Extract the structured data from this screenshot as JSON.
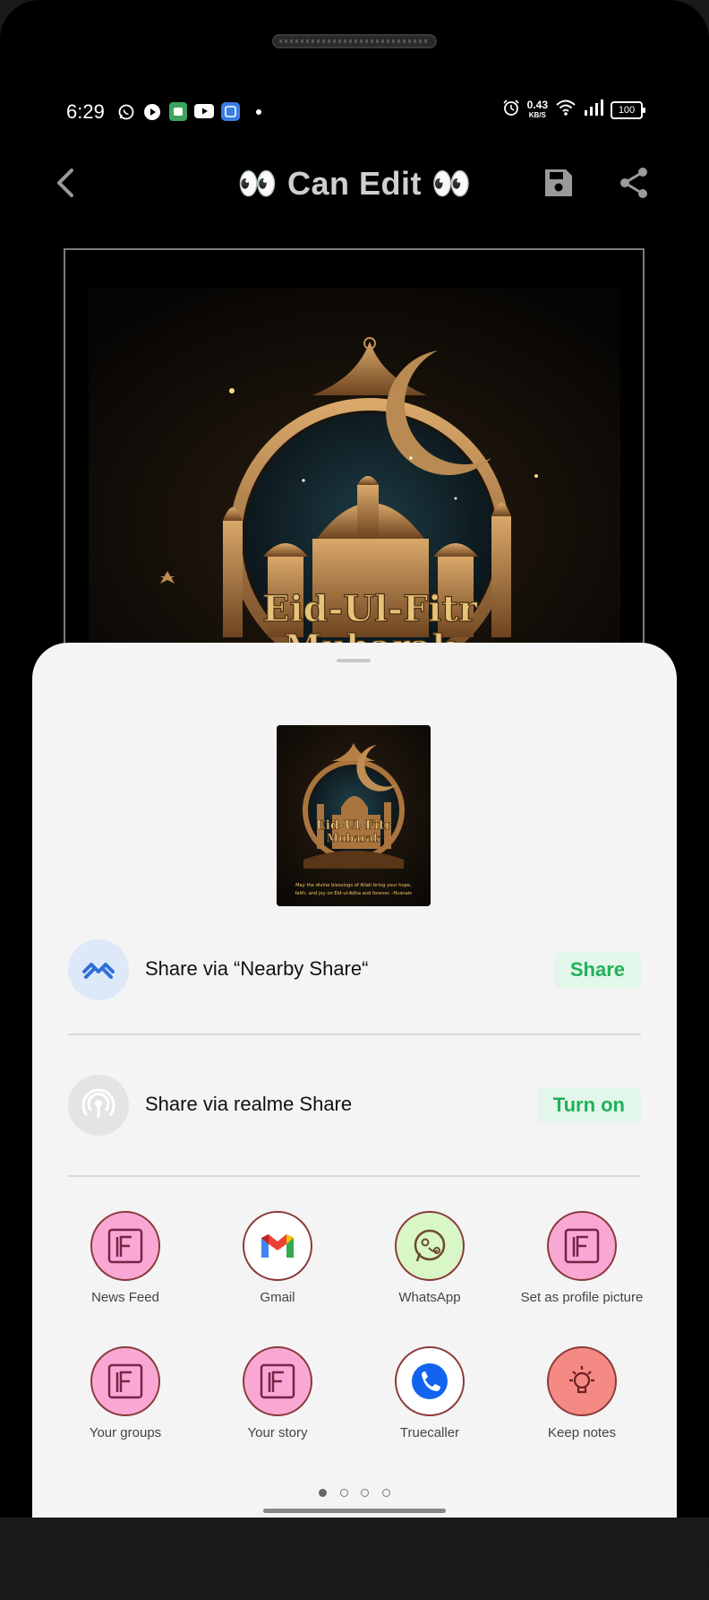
{
  "status_bar": {
    "time": "6:29",
    "speed_value": "0.43",
    "speed_unit": "KB/S",
    "battery": "100",
    "icons": [
      "whatsapp-icon",
      "play-icon",
      "android-app-icon",
      "youtube-icon",
      "gallery-app-icon",
      "dot-icon",
      "alarm-icon",
      "wifi-icon",
      "signal-icon",
      "battery-icon"
    ]
  },
  "toolbar": {
    "title": "👀 Can Edit 👀",
    "icons": [
      "back-icon",
      "save-icon",
      "share-icon"
    ]
  },
  "poster": {
    "heading": "Eid-Ul-Fitr",
    "subheading": "Mubarak",
    "caption_line1": "May the divine blessings of Allah bring your hope,",
    "caption_line2": "faith, and joy on Eid-ul-Adha and forever. -Husnain"
  },
  "share_sheet": {
    "nearby": {
      "label": "Share via “Nearby Share“",
      "button": "Share"
    },
    "realme": {
      "label": "Share via realme Share",
      "button": "Turn on"
    },
    "apps": [
      {
        "label": "News Feed",
        "icon": "facebook-frame-icon"
      },
      {
        "label": "Gmail",
        "icon": "gmail-icon"
      },
      {
        "label": "WhatsApp",
        "icon": "whatsapp-icon"
      },
      {
        "label": "Set as profile picture",
        "icon": "facebook-frame-icon"
      },
      {
        "label": "Your groups",
        "icon": "facebook-frame-icon"
      },
      {
        "label": "Your story",
        "icon": "facebook-frame-icon"
      },
      {
        "label": "Truecaller",
        "icon": "truecaller-icon"
      },
      {
        "label": "Keep notes",
        "icon": "lightbulb-icon"
      }
    ],
    "pages": 4,
    "current_page": 1
  },
  "colors": {
    "accent_green": "#21b05a",
    "facebook_bubble": "#f9a8d4",
    "whatsapp_bubble": "#d9f7c6",
    "keep_bubble": "#f58a84",
    "nearby_bg": "#dde9f8"
  }
}
